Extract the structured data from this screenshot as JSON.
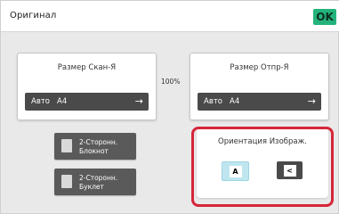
{
  "header": {
    "title": "Оригинал",
    "ok_label": "OK"
  },
  "scan_size": {
    "label": "Размер Скан-Я",
    "mode": "Авто",
    "paper": "A4",
    "arrow": "→"
  },
  "ratio": "100%",
  "send_size": {
    "label": "Размер Отпр-Я",
    "mode": "Авто",
    "paper": "A4",
    "arrow": "→"
  },
  "duplex_buttons": [
    {
      "line1": "2-Сторонн.",
      "line2": "Блокнот",
      "icon": "book-icon"
    },
    {
      "line1": "2-Сторонн.",
      "line2": "Буклет",
      "icon": "booklet-icon"
    }
  ],
  "orientation": {
    "title": "Ориентация Изображ.",
    "portrait_glyph": "A",
    "landscape_glyph": "<",
    "selected": "portrait"
  },
  "colors": {
    "ok_green": "#24b37b",
    "highlight_red": "#d5263a",
    "selected_cyan": "#bfe6ef",
    "dark_button": "#4a4a4a"
  }
}
